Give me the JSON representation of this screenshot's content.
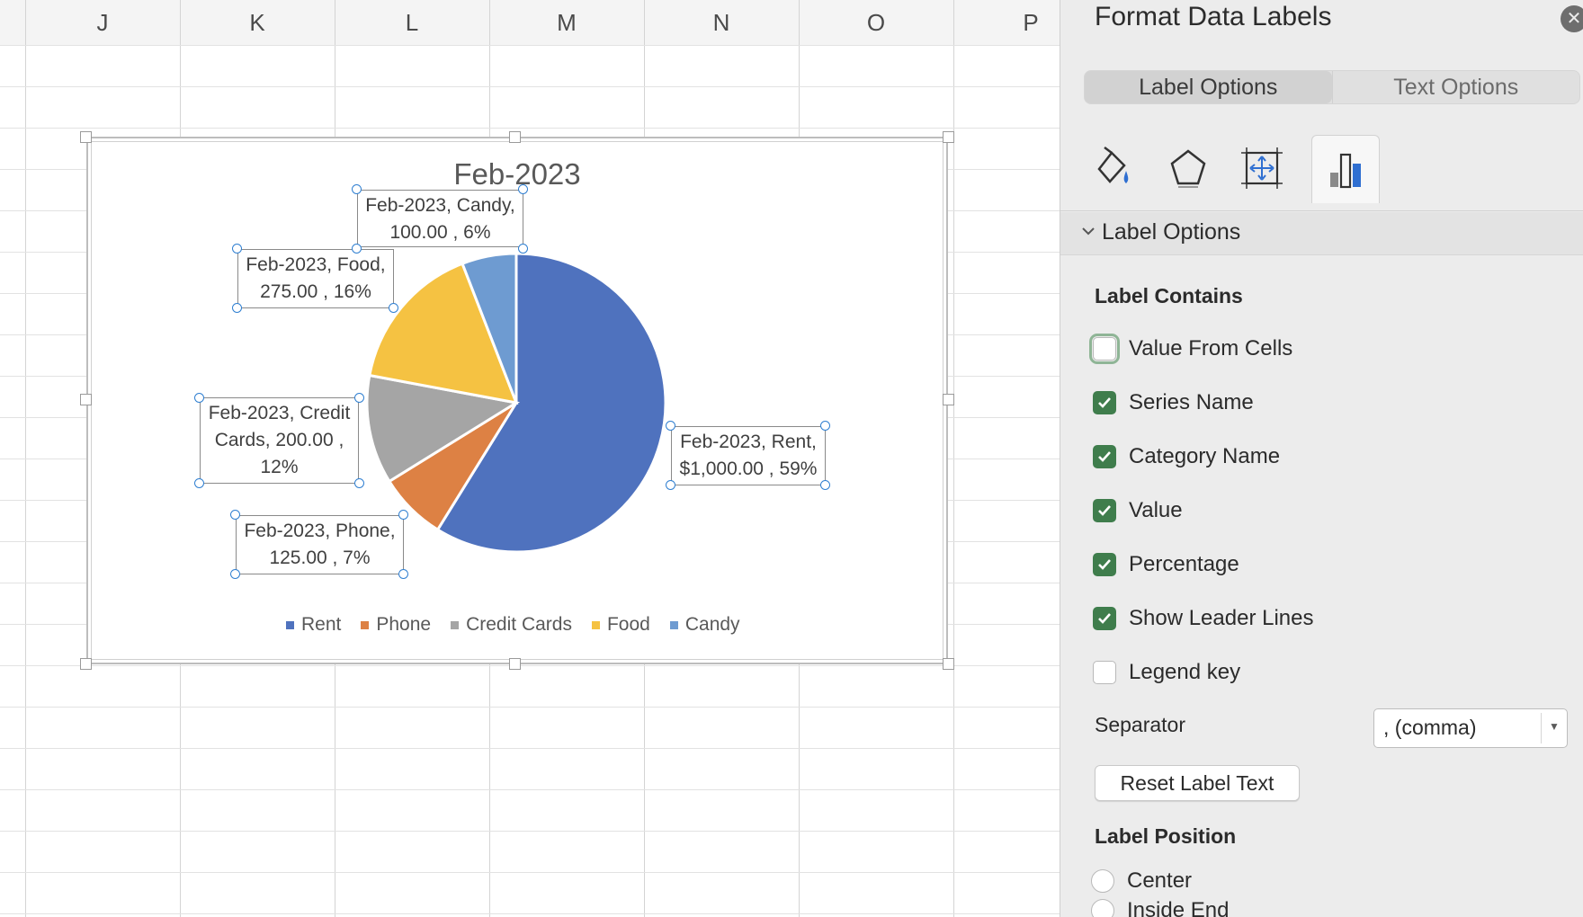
{
  "sheet": {
    "columns": [
      "J",
      "K",
      "L",
      "M",
      "N",
      "O",
      "P"
    ]
  },
  "chart": {
    "title": "Feb-2023",
    "chart_data": {
      "type": "pie",
      "title": "Feb-2023",
      "series": [
        {
          "name": "Feb-2023",
          "categories": [
            "Rent",
            "Phone",
            "Credit Cards",
            "Food",
            "Candy"
          ],
          "values": [
            1000,
            125,
            200,
            275,
            100
          ],
          "percent_labels": [
            "59%",
            "7%",
            "12%",
            "16%",
            "6%"
          ]
        }
      ],
      "colors": [
        "#4f72be",
        "#dd8144",
        "#a5a5a5",
        "#f5c242",
        "#6e9bd1"
      ],
      "legend_position": "bottom"
    },
    "data_labels": {
      "rent": [
        "Feb-2023, Rent,",
        "$1,000.00 , 59%"
      ],
      "phone": [
        "Feb-2023, Phone,",
        "125.00 , 7%"
      ],
      "credit": [
        "Feb-2023, Credit",
        "Cards,  200.00 ,",
        "12%"
      ],
      "food": [
        "Feb-2023, Food,",
        "275.00 , 16%"
      ],
      "candy": [
        "Feb-2023, Candy,",
        "100.00 , 6%"
      ]
    },
    "legend": [
      "Rent",
      "Phone",
      "Credit Cards",
      "Food",
      "Candy"
    ]
  },
  "panel": {
    "title": "Format Data Labels",
    "tabs": [
      "Label Options",
      "Text Options"
    ],
    "active_tab": "Label Options",
    "icon_tabs": [
      "fill-line-icon",
      "effects-icon",
      "size-properties-icon",
      "label-options-icon"
    ],
    "section_title": "Label Options",
    "label_contains": {
      "heading": "Label Contains",
      "items": [
        {
          "label": "Value From Cells",
          "checked": false
        },
        {
          "label": "Series Name",
          "checked": true
        },
        {
          "label": "Category Name",
          "checked": true
        },
        {
          "label": "Value",
          "checked": true
        },
        {
          "label": "Percentage",
          "checked": true
        },
        {
          "label": "Show Leader Lines",
          "checked": true
        },
        {
          "label": "Legend key",
          "checked": false
        }
      ]
    },
    "separator": {
      "label": "Separator",
      "value": ", (comma)"
    },
    "reset_button": "Reset Label Text",
    "label_position": {
      "heading": "Label Position",
      "options": [
        "Center",
        "Inside End"
      ]
    }
  }
}
